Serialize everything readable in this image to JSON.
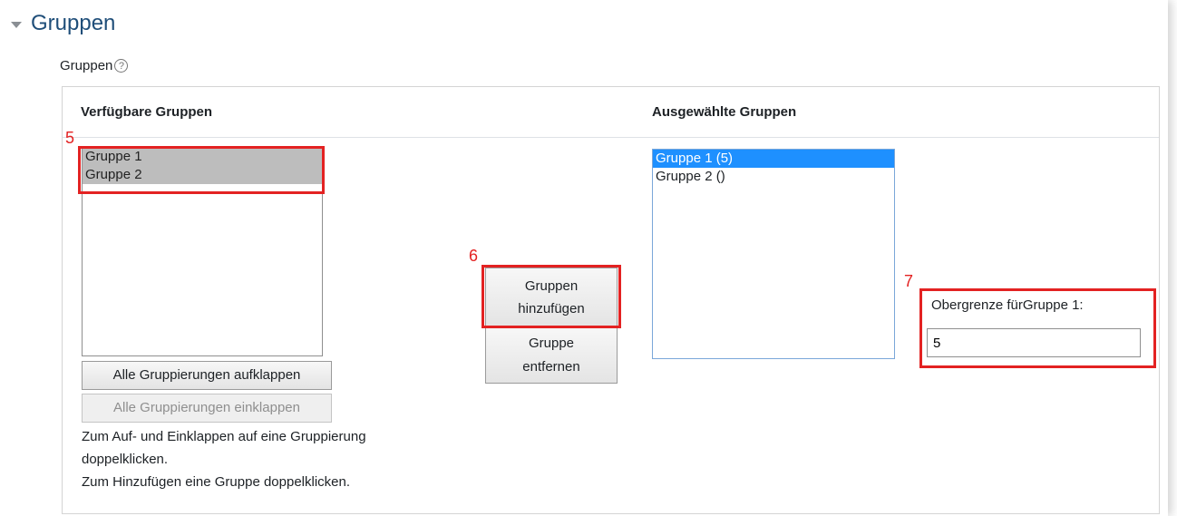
{
  "section": {
    "title": "Gruppen"
  },
  "field": {
    "label": "Gruppen",
    "help_icon": "question-circle-icon"
  },
  "available": {
    "heading": "Verfügbare Gruppen",
    "items": [
      "Gruppe 1",
      "Gruppe 2"
    ]
  },
  "selected": {
    "heading": "Ausgewählte Gruppen",
    "items": [
      "Gruppe 1 (5)",
      "Gruppe 2 ()"
    ]
  },
  "buttons": {
    "expand": "Alle Gruppierungen aufklappen",
    "collapse": "Alle Gruppierungen einklappen",
    "add_line1": "Gruppen",
    "add_line2": "hinzufügen",
    "remove_line1": "Gruppe",
    "remove_line2": "entfernen"
  },
  "hints": {
    "line1": "Zum Auf- und Einklappen auf eine Gruppierung",
    "line2": "doppelklicken.",
    "line3": "Zum Hinzufügen eine Gruppe doppelklicken."
  },
  "limit": {
    "label": "Obergrenze fürGruppe 1:",
    "value": "5"
  },
  "annotations": {
    "n5": "5",
    "n6": "6",
    "n7": "7",
    "color": "#e32222"
  }
}
